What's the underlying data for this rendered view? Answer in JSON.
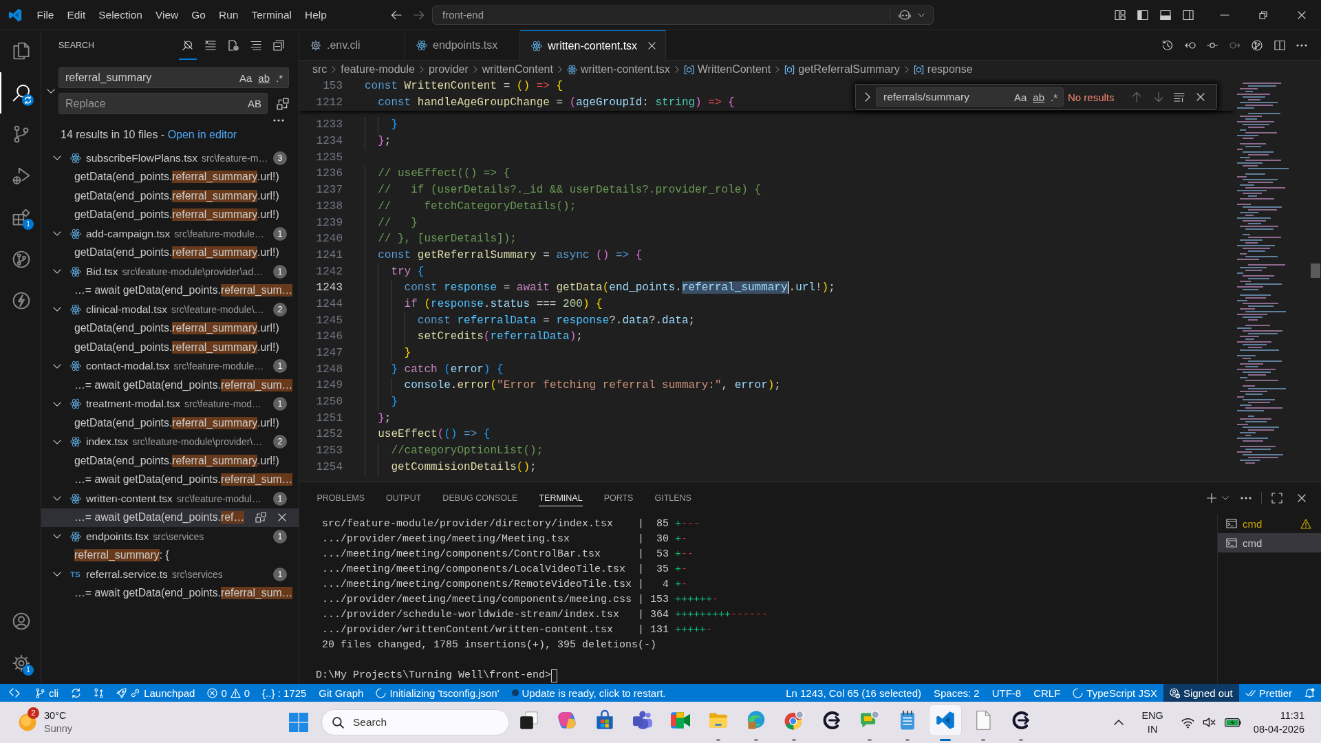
{
  "title_bar": {
    "menu": [
      "File",
      "Edit",
      "Selection",
      "View",
      "Go",
      "Run",
      "Terminal",
      "Help"
    ],
    "command_center": "front-end"
  },
  "activity_bar": {
    "items": [
      {
        "kind": "explorer",
        "selected": false,
        "busy": false
      },
      {
        "kind": "search",
        "selected": true,
        "busy": true
      },
      {
        "kind": "source-control",
        "selected": false,
        "busy": false
      },
      {
        "kind": "run",
        "selected": false,
        "busy": false
      },
      {
        "kind": "extensions",
        "selected": false,
        "busy": false,
        "badge": "1"
      },
      {
        "kind": "git-graph",
        "selected": false,
        "busy": false
      },
      {
        "kind": "bolt",
        "selected": false,
        "busy": false
      }
    ],
    "bottom": [
      {
        "kind": "account"
      },
      {
        "kind": "manage",
        "badge": "1"
      }
    ]
  },
  "search_view": {
    "title": "SEARCH",
    "header_actions": [
      {
        "active": true
      },
      {
        "active": false
      },
      {
        "active": false
      },
      {
        "active": false
      },
      {
        "active": false
      }
    ],
    "query": "referral_summary",
    "query_options": [
      "Aa",
      "ab",
      ".*"
    ],
    "replace_placeholder": "Replace",
    "replace_option": "AB",
    "summary": "14 results in 10 files - ",
    "open_in_editor": "Open in editor",
    "files": [
      {
        "name": "subscribeFlowPlans.tsx",
        "path": "src\\feature-m…",
        "count": "3",
        "kind": "react",
        "expanded": true,
        "matches": [
          {
            "before": "getData(end_points.",
            "match": "referral_summary",
            "after": ".url!)",
            "selected": false
          },
          {
            "before": "getData(end_points.",
            "match": "referral_summary",
            "after": ".url!)",
            "selected": false
          },
          {
            "before": "getData(end_points.",
            "match": "referral_summary",
            "after": ".url!)",
            "selected": false
          }
        ]
      },
      {
        "name": "add-campaign.tsx",
        "path": "src\\feature-module…",
        "count": "1",
        "kind": "react",
        "expanded": true,
        "matches": [
          {
            "before": "getData(end_points.",
            "match": "referral_summary",
            "after": ".url!)",
            "selected": false
          }
        ]
      },
      {
        "name": "Bid.tsx",
        "path": "src\\feature-module\\provider\\ad…",
        "count": "1",
        "kind": "react",
        "expanded": true,
        "matches": [
          {
            "before": "…= await getData(end_points.",
            "match": "referral_sum…",
            "selected": false
          }
        ]
      },
      {
        "name": "clinical-modal.tsx",
        "path": "src\\feature-module\\…",
        "count": "2",
        "kind": "react",
        "expanded": true,
        "matches": [
          {
            "before": "getData(end_points.",
            "match": "referral_summary",
            "after": ".url!)",
            "selected": false
          },
          {
            "before": "getData(end_points.",
            "match": "referral_summary",
            "after": ".url!)",
            "selected": false
          }
        ]
      },
      {
        "name": "contact-modal.tsx",
        "path": "src\\feature-module…",
        "count": "1",
        "kind": "react",
        "expanded": true,
        "matches": [
          {
            "before": "…= await getData(end_points.",
            "match": "referral_sum…",
            "selected": false
          }
        ]
      },
      {
        "name": "treatment-modal.tsx",
        "path": "src\\feature-mod…",
        "count": "1",
        "kind": "react",
        "expanded": true,
        "matches": [
          {
            "before": "getData(end_points.",
            "match": "referral_summary",
            "after": ".url!)",
            "selected": false
          }
        ]
      },
      {
        "name": "index.tsx",
        "path": "src\\feature-module\\provider\\…",
        "count": "2",
        "kind": "react",
        "expanded": true,
        "matches": [
          {
            "before": "getData(end_points.",
            "match": "referral_summary",
            "after": ".url!)",
            "selected": false
          },
          {
            "before": "…= await getData(end_points.",
            "match": "referral_sum…",
            "selected": false
          }
        ]
      },
      {
        "name": "written-content.tsx",
        "path": "src\\feature-modul…",
        "count": "1",
        "kind": "react",
        "expanded": true,
        "matches": [
          {
            "before": "…= await getData(end_points.",
            "match": "ref…",
            "selected": true
          }
        ]
      },
      {
        "name": "endpoints.tsx",
        "path": "src\\services",
        "count": "1",
        "kind": "react",
        "expanded": true,
        "matches": [
          {
            "match": "referral_summary",
            "after": ": {",
            "selected": false
          }
        ]
      },
      {
        "name": "referral.service.ts",
        "path": "src\\services",
        "count": "1",
        "kind": "ts",
        "type_label": "TS",
        "expanded": true,
        "matches": [
          {
            "before": "…= await getData(end_points.",
            "match": "referral_sum…",
            "selected": false
          }
        ]
      }
    ]
  },
  "editor": {
    "tabs": [
      {
        "label": ".env.cli",
        "kind": "settings",
        "selected": false
      },
      {
        "label": "endpoints.tsx",
        "kind": "react",
        "selected": false
      },
      {
        "label": "written-content.tsx",
        "kind": "react",
        "selected": true
      }
    ],
    "breadcrumbs": [
      {
        "label": "src",
        "kind": "folder"
      },
      {
        "label": "feature-module",
        "kind": "folder"
      },
      {
        "label": "provider",
        "kind": "folder"
      },
      {
        "label": "writtenContent",
        "kind": "folder"
      },
      {
        "label": "written-content.tsx",
        "kind": "react"
      },
      {
        "label": "WrittenContent",
        "kind": "symbol"
      },
      {
        "label": "getReferralSummary",
        "kind": "symbol"
      },
      {
        "label": "response",
        "kind": "symbol"
      }
    ],
    "find": {
      "query": "referrals/summary",
      "options": [
        "Aa",
        "ab",
        ".*"
      ],
      "status": "No results"
    },
    "sticky_lines": [
      {
        "number": "153",
        "tokens": [
          {
            "text": "const ",
            "kind": "keyword"
          },
          {
            "text": "WrittenContent",
            "kind": "function"
          },
          {
            "text": " = ",
            "kind": "plain"
          },
          {
            "text": "() ",
            "kind": "bracket1"
          },
          {
            "text": "=> ",
            "kind": "arrow"
          },
          {
            "text": "{",
            "kind": "bracket1"
          }
        ]
      },
      {
        "number": "1212",
        "tokens": [
          {
            "text": "  const ",
            "kind": "keyword"
          },
          {
            "text": "handleAgeGroupChange",
            "kind": "function"
          },
          {
            "text": " = ",
            "kind": "plain"
          },
          {
            "text": "(",
            "kind": "bracket2"
          },
          {
            "text": "ageGroupId",
            "kind": "variable"
          },
          {
            "text": ": ",
            "kind": "plain"
          },
          {
            "text": "string",
            "kind": "type"
          },
          {
            "text": ") ",
            "kind": "bracket2"
          },
          {
            "text": "=> ",
            "kind": "arrow"
          },
          {
            "text": "{",
            "kind": "bracket2"
          }
        ]
      }
    ],
    "lines": [
      {
        "number": "1233",
        "current": false,
        "tokens": [
          {
            "text": "    }",
            "kind": "bracket3"
          }
        ]
      },
      {
        "number": "1234",
        "current": false,
        "tokens": [
          {
            "text": "  }",
            "kind": "bracket2"
          },
          {
            "text": ";",
            "kind": "plain"
          }
        ]
      },
      {
        "number": "1235",
        "current": false
      },
      {
        "number": "1236",
        "current": false,
        "tokens": [
          {
            "text": "  // useEffect(() => {",
            "kind": "comment"
          }
        ]
      },
      {
        "number": "1237",
        "current": false,
        "tokens": [
          {
            "text": "  //   if (userDetails?._id && userDetails?.provider_role) {",
            "kind": "comment"
          }
        ]
      },
      {
        "number": "1238",
        "current": false,
        "tokens": [
          {
            "text": "  //     fetchCategoryDetails();",
            "kind": "comment"
          }
        ]
      },
      {
        "number": "1239",
        "current": false,
        "tokens": [
          {
            "text": "  //   }",
            "kind": "comment"
          }
        ]
      },
      {
        "number": "1240",
        "current": false,
        "tokens": [
          {
            "text": "  // }, [userDetails]);",
            "kind": "comment"
          }
        ]
      },
      {
        "number": "1241",
        "current": false,
        "tokens": [
          {
            "text": "  const ",
            "kind": "keyword"
          },
          {
            "text": "getReferralSummary",
            "kind": "function"
          },
          {
            "text": " = ",
            "kind": "plain"
          },
          {
            "text": "async ",
            "kind": "keyword"
          },
          {
            "text": "() ",
            "kind": "bracket2"
          },
          {
            "text": "=> ",
            "kind": "keyword"
          },
          {
            "text": "{",
            "kind": "bracket2"
          }
        ]
      },
      {
        "number": "1242",
        "current": false,
        "tokens": [
          {
            "text": "    try ",
            "kind": "control"
          },
          {
            "text": "{",
            "kind": "bracket3"
          }
        ]
      },
      {
        "number": "1243",
        "current": true,
        "tokens": [
          {
            "text": "      const ",
            "kind": "keyword"
          },
          {
            "text": "response",
            "kind": "constant"
          },
          {
            "text": " = ",
            "kind": "plain"
          },
          {
            "text": "await ",
            "kind": "control"
          },
          {
            "text": "getData",
            "kind": "function"
          },
          {
            "text": "(",
            "kind": "bracket1"
          },
          {
            "text": "end_points",
            "kind": "variable"
          },
          {
            "text": ".",
            "kind": "plain"
          },
          {
            "text": "referral_summary",
            "kind": "selection"
          },
          {
            "text": ".",
            "kind": "plain"
          },
          {
            "text": "url",
            "kind": "variable"
          },
          {
            "text": "!",
            "kind": "plain"
          },
          {
            "text": ")",
            "kind": "bracket1"
          },
          {
            "text": ";",
            "kind": "plain"
          }
        ]
      },
      {
        "number": "1244",
        "current": false,
        "tokens": [
          {
            "text": "      if ",
            "kind": "control"
          },
          {
            "text": "(",
            "kind": "bracket1"
          },
          {
            "text": "response",
            "kind": "constant"
          },
          {
            "text": ".",
            "kind": "plain"
          },
          {
            "text": "status",
            "kind": "variable"
          },
          {
            "text": " === ",
            "kind": "plain"
          },
          {
            "text": "200",
            "kind": "number"
          },
          {
            "text": ") ",
            "kind": "bracket1"
          },
          {
            "text": "{",
            "kind": "bracket1"
          }
        ]
      },
      {
        "number": "1245",
        "current": false,
        "tokens": [
          {
            "text": "        const ",
            "kind": "keyword"
          },
          {
            "text": "referralData",
            "kind": "constant"
          },
          {
            "text": " = ",
            "kind": "plain"
          },
          {
            "text": "response",
            "kind": "constant"
          },
          {
            "text": "?.",
            "kind": "plain"
          },
          {
            "text": "data",
            "kind": "variable"
          },
          {
            "text": "?.",
            "kind": "plain"
          },
          {
            "text": "data",
            "kind": "variable"
          },
          {
            "text": ";",
            "kind": "plain"
          }
        ]
      },
      {
        "number": "1246",
        "current": false,
        "tokens": [
          {
            "text": "        setCredits",
            "kind": "function"
          },
          {
            "text": "(",
            "kind": "bracket2"
          },
          {
            "text": "referralData",
            "kind": "constant"
          },
          {
            "text": ")",
            "kind": "bracket2"
          },
          {
            "text": ";",
            "kind": "plain"
          }
        ]
      },
      {
        "number": "1247",
        "current": false,
        "tokens": [
          {
            "text": "      }",
            "kind": "bracket1"
          }
        ]
      },
      {
        "number": "1248",
        "current": false,
        "tokens": [
          {
            "text": "    } ",
            "kind": "bracket3"
          },
          {
            "text": "catch ",
            "kind": "control"
          },
          {
            "text": "(",
            "kind": "bracket3"
          },
          {
            "text": "error",
            "kind": "variable"
          },
          {
            "text": ") ",
            "kind": "bracket3"
          },
          {
            "text": "{",
            "kind": "bracket3"
          }
        ]
      },
      {
        "number": "1249",
        "current": false,
        "tokens": [
          {
            "text": "      console",
            "kind": "variable"
          },
          {
            "text": ".",
            "kind": "plain"
          },
          {
            "text": "error",
            "kind": "function"
          },
          {
            "text": "(",
            "kind": "bracket1"
          },
          {
            "text": "\"Error fetching referral summary:\"",
            "kind": "string"
          },
          {
            "text": ", ",
            "kind": "plain"
          },
          {
            "text": "error",
            "kind": "variable"
          },
          {
            "text": ")",
            "kind": "bracket1"
          },
          {
            "text": ";",
            "kind": "plain"
          }
        ]
      },
      {
        "number": "1250",
        "current": false,
        "tokens": [
          {
            "text": "    }",
            "kind": "bracket3"
          }
        ]
      },
      {
        "number": "1251",
        "current": false,
        "tokens": [
          {
            "text": "  }",
            "kind": "bracket2"
          },
          {
            "text": ";",
            "kind": "plain"
          }
        ]
      },
      {
        "number": "1252",
        "current": false,
        "tokens": [
          {
            "text": "  useEffect",
            "kind": "function"
          },
          {
            "text": "(",
            "kind": "bracket2"
          },
          {
            "text": "() ",
            "kind": "bracket3"
          },
          {
            "text": "=> ",
            "kind": "keyword"
          },
          {
            "text": "{",
            "kind": "bracket3"
          }
        ]
      },
      {
        "number": "1253",
        "current": false,
        "tokens": [
          {
            "text": "    //categoryOptionList();",
            "kind": "comment"
          }
        ]
      },
      {
        "number": "1254",
        "current": false,
        "tokens": [
          {
            "text": "    getCommisionDetails",
            "kind": "function"
          },
          {
            "text": "()",
            "kind": "bracket1"
          },
          {
            "text": ";",
            "kind": "plain"
          }
        ]
      }
    ]
  },
  "panel": {
    "tabs": [
      {
        "label": "PROBLEMS",
        "selected": false
      },
      {
        "label": "OUTPUT",
        "selected": false
      },
      {
        "label": "DEBUG CONSOLE",
        "selected": false
      },
      {
        "label": "TERMINAL",
        "selected": true
      },
      {
        "label": "PORTS",
        "selected": false
      },
      {
        "label": "GITLENS",
        "selected": false
      }
    ],
    "terminal": {
      "stat_lines": [
        {
          "text": " src/feature-module/provider/directory/index.tsx    |  85 ",
          "added": "+",
          "removed": "---"
        },
        {
          "text": " .../provider/meeting/meeting/Meeting.tsx           |  30 ",
          "added": "+",
          "removed": "-"
        },
        {
          "text": " .../meeting/meeting/components/ControlBar.tsx      |  53 ",
          "added": "+",
          "removed": "--"
        },
        {
          "text": " .../meeting/meeting/components/LocalVideoTile.tsx  |  35 ",
          "added": "+",
          "removed": "-"
        },
        {
          "text": " .../meeting/meeting/components/RemoteVideoTile.tsx |   4 ",
          "added": "+",
          "removed": "-"
        },
        {
          "text": " .../provider/meeting/meeting/components/meeing.css | 153 ",
          "added": "++++++",
          "removed": "-"
        },
        {
          "text": " .../provider/schedule-worldwide-stream/index.tsx   | 364 ",
          "added": "+++++++++",
          "removed": "------"
        },
        {
          "text": " .../provider/writtenContent/written-content.tsx    | 131 ",
          "added": "+++++",
          "removed": "-"
        }
      ],
      "summary": " 20 files changed, 1785 insertions(+), 395 deletions(-)",
      "prompt": "D:\\My Projects\\Turning Well\\front-end>"
    },
    "terminals": [
      {
        "label": "cmd",
        "warning": true,
        "selected": false
      },
      {
        "label": "cmd",
        "warning": false,
        "selected": true
      }
    ]
  },
  "status_bar": {
    "left": [
      {
        "kind": "remote"
      },
      {
        "kind": "branch",
        "text": "cli"
      },
      {
        "kind": "sync"
      },
      {
        "kind": "compare"
      },
      {
        "kind": "launchpad",
        "text": "Launchpad"
      },
      {
        "kind": "problems",
        "errors": "0",
        "warnings": "0"
      },
      {
        "kind": "plain",
        "text": "{..} : 1725"
      },
      {
        "kind": "plain",
        "text": "Git Graph"
      },
      {
        "kind": "loading",
        "text": "Initializing 'tsconfig.json'"
      },
      {
        "kind": "update",
        "text": "Update is ready, click to restart."
      }
    ],
    "right": [
      {
        "kind": "plain",
        "text": "Ln 1243, Col 65 (16 selected)"
      },
      {
        "kind": "plain",
        "text": "Spaces: 2"
      },
      {
        "kind": "plain",
        "text": "UTF-8"
      },
      {
        "kind": "plain",
        "text": "CRLF"
      },
      {
        "kind": "loading",
        "text": "TypeScript JSX"
      },
      {
        "kind": "account",
        "text": "Signed out"
      },
      {
        "kind": "check",
        "text": "Prettier"
      },
      {
        "kind": "bell"
      }
    ]
  },
  "taskbar": {
    "weather": {
      "badge": "2",
      "temperature": "30°C",
      "condition": "Sunny"
    },
    "search_placeholder": "Search",
    "apps": [
      {
        "kind": "task-view",
        "running": false,
        "selected": false
      },
      {
        "kind": "assistant",
        "running": false,
        "selected": false
      },
      {
        "kind": "store",
        "running": false,
        "selected": false
      },
      {
        "kind": "team-chat",
        "running": false,
        "selected": false
      },
      {
        "kind": "video-call",
        "running": false,
        "selected": false
      },
      {
        "kind": "folder",
        "running": true,
        "selected": false
      },
      {
        "kind": "browser-wave",
        "running": true,
        "selected": false
      },
      {
        "kind": "browser-ring",
        "running": true,
        "selected": false
      },
      {
        "kind": "c-logo",
        "running": false,
        "selected": false
      },
      {
        "kind": "chat",
        "running": true,
        "selected": false
      },
      {
        "kind": "notepad",
        "running": true,
        "selected": false
      },
      {
        "kind": "code-editor",
        "running": true,
        "selected": true
      },
      {
        "kind": "document",
        "running": true,
        "selected": false
      },
      {
        "kind": "c-logo",
        "running": true,
        "selected": false
      }
    ],
    "tray": {
      "language": "ENG",
      "region": "IN",
      "time": "11:31",
      "date": "08-04-2026"
    }
  }
}
